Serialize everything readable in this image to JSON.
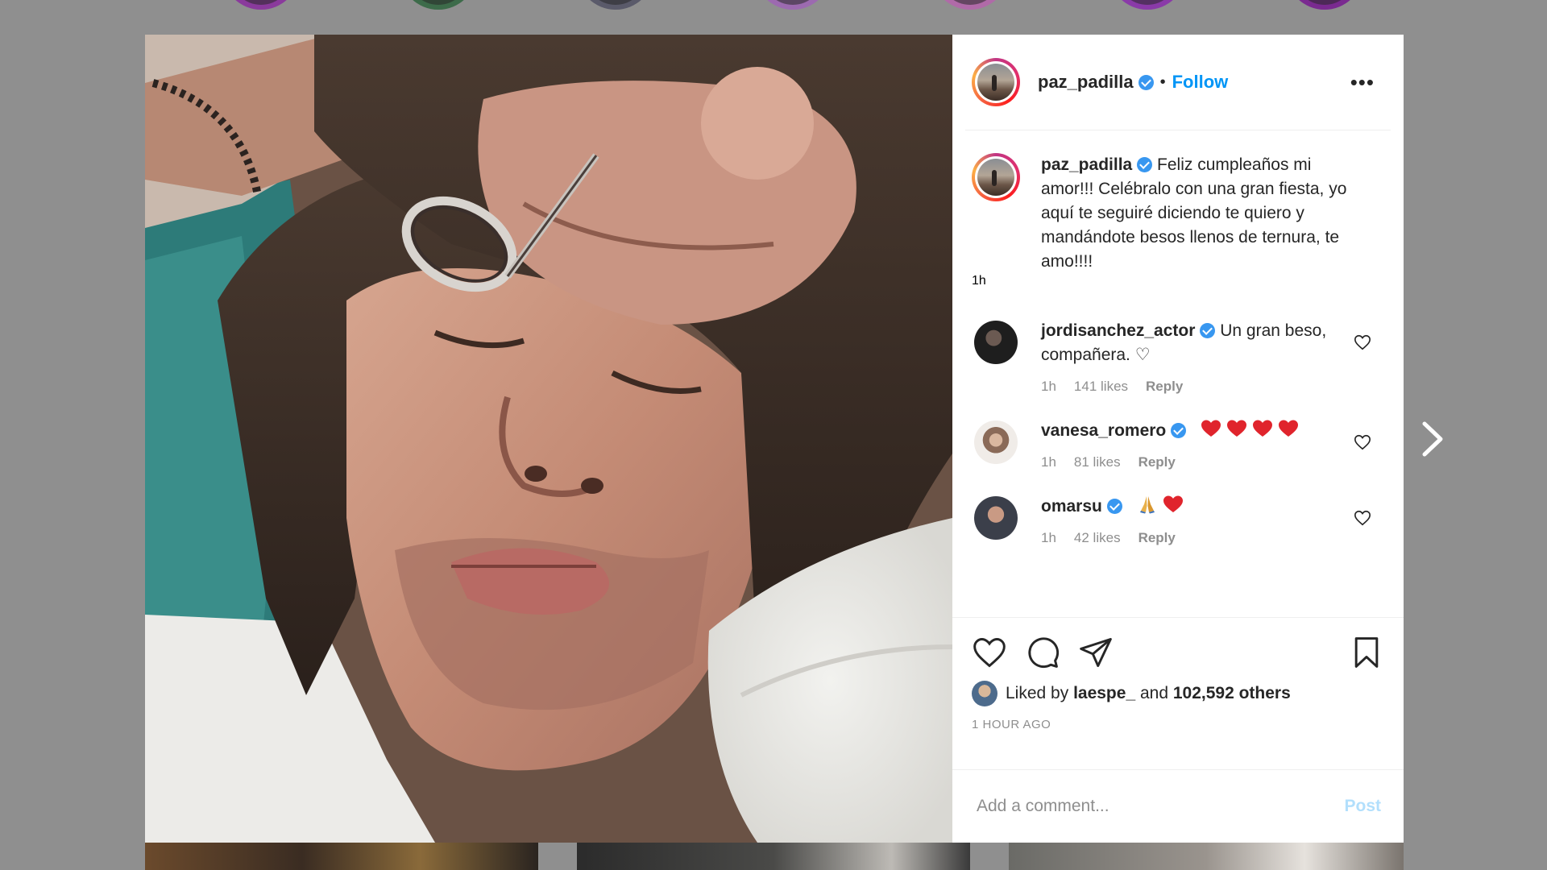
{
  "post": {
    "author": "paz_padilla",
    "separator": "•",
    "follow_label": "Follow",
    "more_label": "•••",
    "caption": "Feliz cumpleaños mi amor!!! Celébralo con una gran fiesta, yo aquí te seguiré diciendo te quiero y mandándote besos llenos de ternura, te amo!!!!",
    "caption_time": "1h",
    "comments": [
      {
        "user": "jordisanchez_actor",
        "text": "Un gran beso, compañera. ♡",
        "time": "1h",
        "likes": "141 likes",
        "reply": "Reply"
      },
      {
        "user": "vanesa_romero",
        "text": "",
        "time": "1h",
        "likes": "81 likes",
        "reply": "Reply"
      },
      {
        "user": "omarsu",
        "text": "",
        "time": "1h",
        "likes": "42 likes",
        "reply": "Reply"
      }
    ],
    "liked_by_prefix": "Liked by",
    "liked_by_user": "laespe_",
    "liked_by_and": "and",
    "liked_by_others": "102,592 others",
    "posted_ago": "1 HOUR AGO",
    "add_comment_placeholder": "Add a comment...",
    "post_label": "Post"
  },
  "icons": {
    "like": "heart-outline-icon",
    "comment": "comment-bubble-icon",
    "share": "paper-plane-icon",
    "save": "bookmark-icon",
    "next": "chevron-right-icon",
    "verified": "verified-badge-icon"
  },
  "colors": {
    "follow": "#0095f6",
    "verified": "#3897f0",
    "post_disabled": "#b2dffc",
    "backdrop": "#8f8f8f"
  }
}
